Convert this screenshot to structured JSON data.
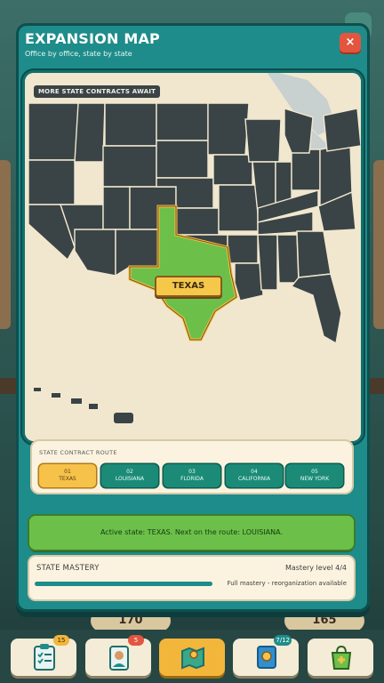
{
  "background": {
    "left_counter": "170",
    "right_counter": "165"
  },
  "modal": {
    "title": "EXPANSION MAP",
    "subtitle": "Office by office, state by state",
    "close_label": "×"
  },
  "map": {
    "badge": "MORE STATE CONTRACTS AWAIT",
    "highlighted_state": "TEXAS",
    "colors": {
      "land": "#3a4446",
      "water": "#c8d0d0",
      "paper": "#f1e7cf",
      "highlight": "#6cc04a"
    }
  },
  "route": {
    "title": "STATE CONTRACT ROUTE",
    "stops": [
      {
        "num": "01",
        "name": "TEXAS",
        "active": true
      },
      {
        "num": "02",
        "name": "LOUISIANA",
        "active": false
      },
      {
        "num": "03",
        "name": "FLORIDA",
        "active": false
      },
      {
        "num": "04",
        "name": "CALIFORNIA",
        "active": false
      },
      {
        "num": "05",
        "name": "NEW YORK",
        "active": false
      }
    ]
  },
  "active_state": {
    "message": "Active state: TEXAS. Next on the route: LOUISIANA."
  },
  "mastery": {
    "title": "STATE MASTERY",
    "level": "Mastery level 4/4",
    "progress": 1.0,
    "note": "Full mastery - reorganization available"
  },
  "nav": {
    "items": [
      {
        "icon": "clipboard-icon",
        "badge": "15",
        "badge_color": "#f2b63a"
      },
      {
        "icon": "employee-badge-icon",
        "badge": "5",
        "badge_color": "#e2553f"
      },
      {
        "icon": "map-icon",
        "badge": "",
        "active": true
      },
      {
        "icon": "certificate-icon",
        "badge": "7/12",
        "badge_color": "#1e8c8a"
      },
      {
        "icon": "shopping-bag-icon",
        "badge": ""
      }
    ]
  }
}
